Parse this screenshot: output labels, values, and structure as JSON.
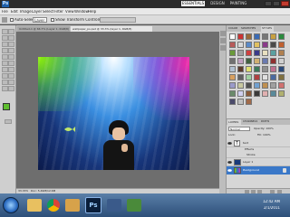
{
  "app": {
    "logo": "Ps",
    "workspace_buttons": [
      "ESSENTIALS",
      "DESIGN",
      "PAINTING"
    ]
  },
  "menu": [
    "File",
    "Edit",
    "Image",
    "Layer",
    "Select",
    "Filter",
    "View",
    "Window",
    "Help"
  ],
  "options": {
    "auto_select": "Auto-Select:",
    "auto_select_value": "Layer",
    "transform_controls": "Show Transform Controls"
  },
  "document": {
    "tab1": "Untitled-1 @ 66.7% (Layer 1, RGB/8)",
    "tab2": "wallpaper_ps.psd @ 33.3% (layer 1, RGB/8)",
    "zoom_status": "33.33%",
    "doc_size": "Doc: 5.49M/12.6M"
  },
  "panels": {
    "tabs": [
      "COLOR",
      "SWATCHES",
      "STYLES"
    ],
    "layers_tabs": [
      "LAYERS",
      "CHANNELS",
      "PATHS"
    ],
    "blend_mode": "Normal",
    "opacity": "Opacity: 100%",
    "fill": "Fill: 100%",
    "lock": "Lock:"
  },
  "layers": [
    {
      "name": "text",
      "type": "text"
    },
    {
      "name": "Effects",
      "type": "effect"
    },
    {
      "name": "Stroke",
      "type": "effect"
    },
    {
      "name": "Layer 1",
      "type": "image"
    },
    {
      "name": "Background",
      "type": "background"
    }
  ],
  "taskbar": {
    "time": "12:42 AM",
    "date": "2/1/2011"
  },
  "colors": {
    "accent": "#7fd000",
    "foreground_swatch": "#5fbf2f",
    "background_swatch": "#ffffff"
  }
}
